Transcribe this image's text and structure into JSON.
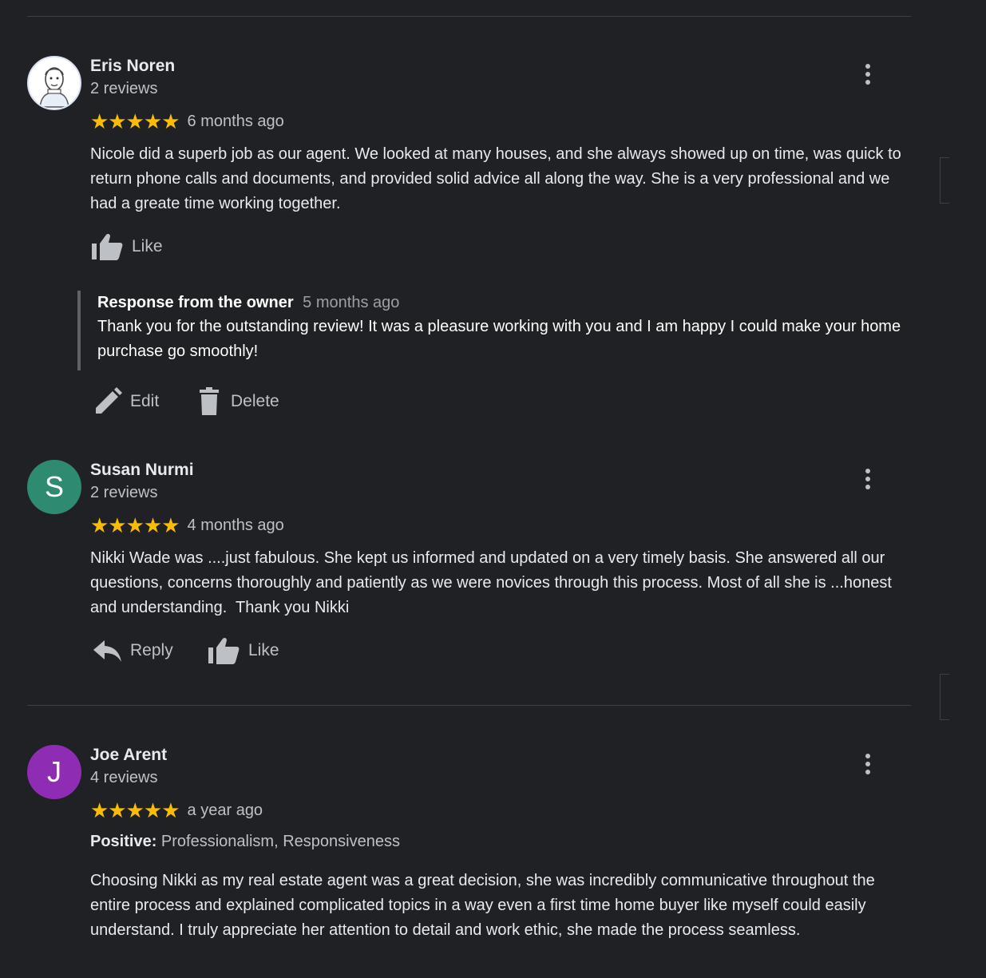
{
  "colors": {
    "background": "#202124",
    "star": "#fbbc04",
    "avatar_susan": "#2f8a72",
    "avatar_joe": "#8e2db3"
  },
  "reviews": [
    {
      "name": "Eris Noren",
      "count": "2 reviews",
      "stars": "★★★★★",
      "rating": 5,
      "when": "6 months ago",
      "text": "Nicole did a superb job as our agent. We looked at many houses, and she always showed up on time, was quick to return phone calls and documents, and provided solid advice all along the way. She is a very professional and we had a greate time working together.",
      "like_label": "Like",
      "response": {
        "title": "Response from the owner",
        "when": "5 months ago",
        "text": "Thank you for the outstanding review! It was a pleasure working with you and I am happy I could make your home purchase go smoothly!",
        "edit_label": "Edit",
        "delete_label": "Delete"
      }
    },
    {
      "name": "Susan Nurmi",
      "initial": "S",
      "count": "2 reviews",
      "stars": "★★★★★",
      "rating": 5,
      "when": "4 months ago",
      "text": "Nikki Wade was ....just fabulous. She kept us informed and updated on a very timely basis. She answered all our questions, concerns thoroughly and patiently as we were novices through this process. Most of all she is ...honest and understanding.  Thank you Nikki",
      "reply_label": "Reply",
      "like_label": "Like"
    },
    {
      "name": "Joe Arent",
      "initial": "J",
      "count": "4 reviews",
      "stars": "★★★★★",
      "rating": 5,
      "when": "a year ago",
      "positive_label": "Positive:",
      "positive_values": "Professionalism, Responsiveness",
      "text": "Choosing Nikki as my real estate agent was a great decision, she was incredibly communicative throughout the entire process and explained complicated topics in a way even a first time home buyer like myself could easily understand. I truly appreciate her attention to detail and work ethic, she made the process seamless."
    }
  ]
}
